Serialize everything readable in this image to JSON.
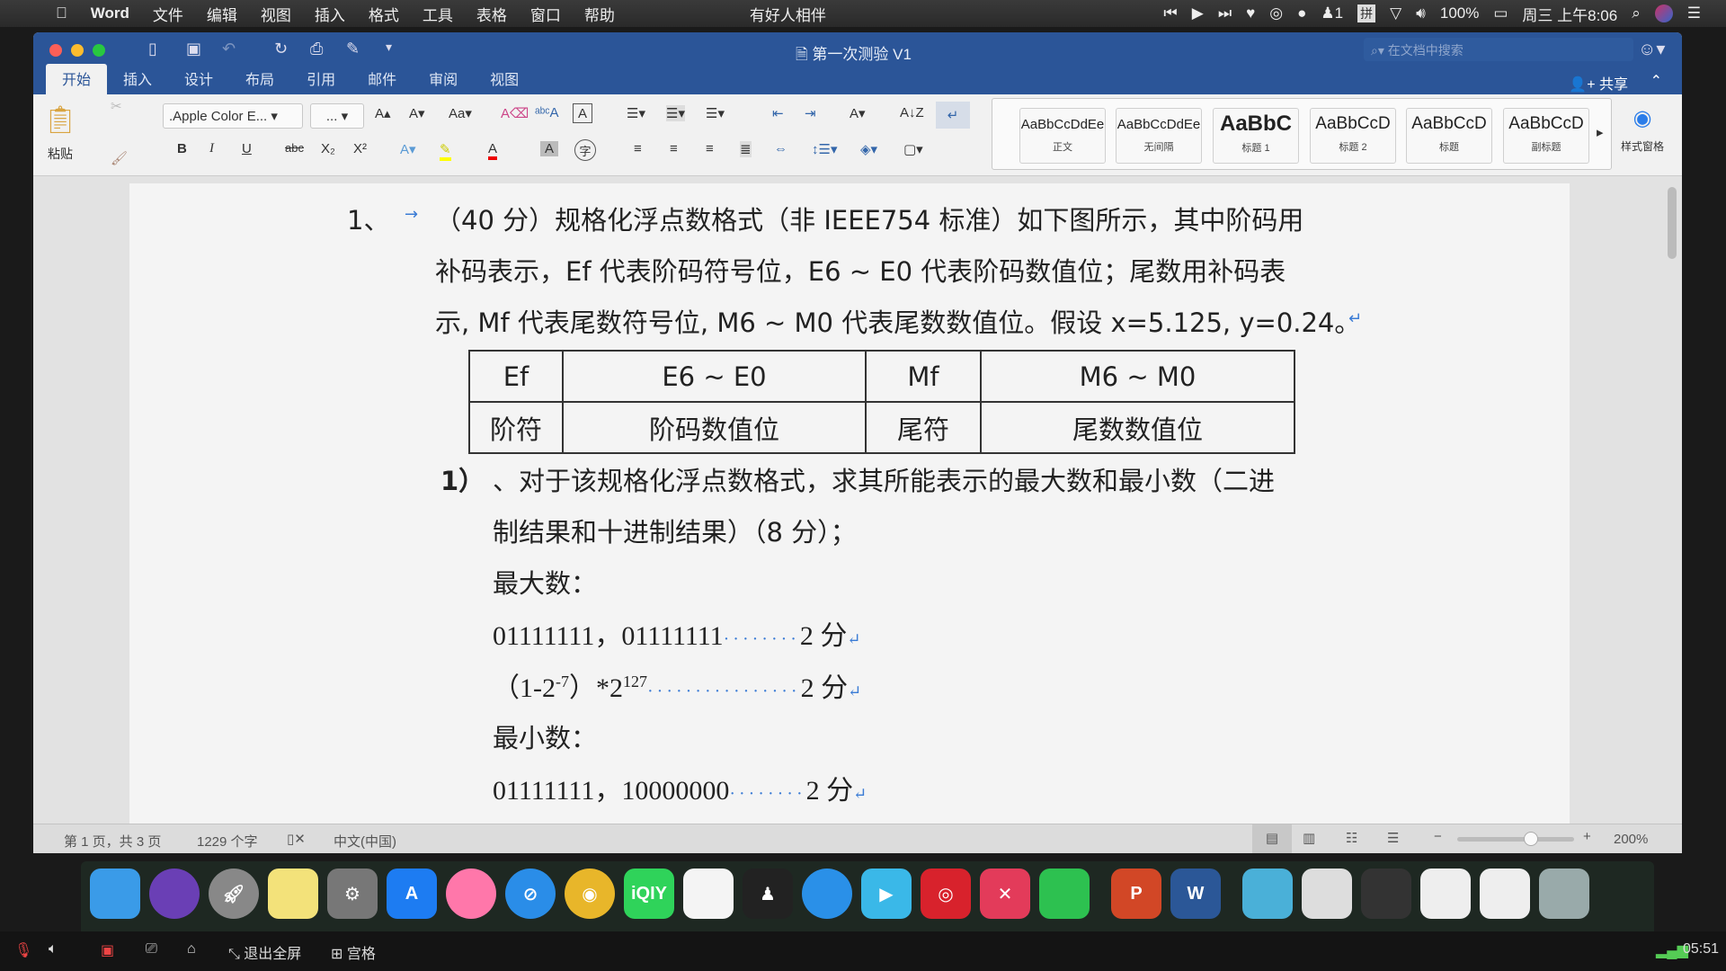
{
  "menubar": {
    "app": "Word",
    "items": [
      "文件",
      "编辑",
      "视图",
      "插入",
      "格式",
      "工具",
      "表格",
      "窗口",
      "帮助"
    ],
    "center": "有好人相伴",
    "notification_count": "1",
    "input_method": "拼",
    "battery": "100%",
    "datetime": "周三 上午8:06"
  },
  "window": {
    "title": "第一次测验 V1",
    "search_placeholder": "在文档中搜索",
    "share": "共享"
  },
  "tabs": [
    "开始",
    "插入",
    "设计",
    "布局",
    "引用",
    "邮件",
    "审阅",
    "视图"
  ],
  "ribbon": {
    "paste": "粘贴",
    "font_name": ".Apple Color E...",
    "font_size": "...",
    "bold": "B",
    "italic": "I",
    "underline": "U",
    "strike": "abc",
    "sub": "X₂",
    "sup": "X²",
    "styles": [
      {
        "preview": "AaBbCcDdEe",
        "label": "正文"
      },
      {
        "preview": "AaBbCcDdEe",
        "label": "无间隔"
      },
      {
        "preview": "AaBbC",
        "label": "标题 1"
      },
      {
        "preview": "AaBbCcD",
        "label": "标题 2"
      },
      {
        "preview": "AaBbCcD",
        "label": "标题"
      },
      {
        "preview": "AaBbCcD",
        "label": "副标题"
      }
    ],
    "styles_pane": "样式窗格"
  },
  "document": {
    "q_num": "1、",
    "para_lines": [
      "（40 分）规格化浮点数格式（非 IEEE754 标准）如下图所示，其中阶码用",
      "补码表示，Ef 代表阶码符号位，E6 ~ E0 代表阶码数值位；尾数用补码表",
      "示, Mf 代表尾数符号位, M6 ~ M0 代表尾数数值位。假设 x=5.125, y=0.24。"
    ],
    "table": [
      [
        "Ef",
        "E6 ~ E0",
        "Mf",
        "M6 ~ M0"
      ],
      [
        "阶符",
        "阶码数值位",
        "尾符",
        "尾数数值位"
      ]
    ],
    "sub_q_num": "1）",
    "sub_q_lines": [
      "、对于该规格化浮点数格式，求其所能表示的最大数和最小数（二进",
      "制结果和十进制结果）（8 分）；"
    ],
    "max_label": "最大数：",
    "max_bin": "01111111，01111111",
    "max_dec_base": "（1-2",
    "max_dec_exp1": "-7",
    "max_dec_mid": "）*2",
    "max_dec_exp2": "127",
    "min_label": "最小数：",
    "min_bin": "01111111，10000000",
    "score": "2 分"
  },
  "statusbar": {
    "page": "第 1 页，共 3 页",
    "words": "1229 个字",
    "language": "中文(中国)",
    "zoom": "200%",
    "zoom_level_percent": 200
  },
  "dock": [
    "finder",
    "siri",
    "launchpad",
    "stickies",
    "system-preferences",
    "app-store",
    "photos",
    "safari",
    "chrome",
    "iqiyi",
    "baidu-netdisk",
    "qq",
    "dingtalk",
    "tencent-video",
    "netease-music",
    "xmind",
    "wechat",
    "powerpoint",
    "word",
    "folder",
    "word-window",
    "terminal-window",
    "powerpoint-window",
    "chrome-window",
    "trash"
  ],
  "bottombar": {
    "exit_fullscreen": "退出全屏",
    "grid": "宫格",
    "time": "05:51"
  }
}
